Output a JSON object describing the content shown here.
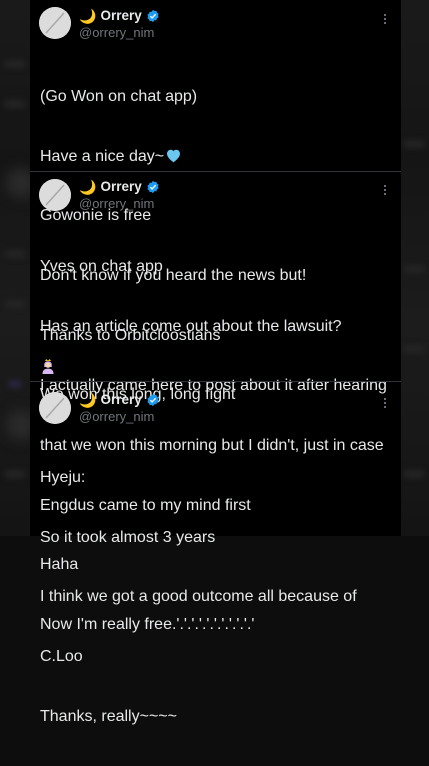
{
  "tweets": [
    {
      "author": {
        "moon": "🌙",
        "display_name": "Orrery",
        "handle": "@orrery_nim",
        "verified": true
      },
      "lines": [
        "(Go Won on chat app)",
        "Have a nice day~",
        "Gowonie is free",
        "Don't know if you heard the news but!",
        "Thanks to Orbitcloostians",
        "We won this long, long fight"
      ],
      "trailing_emoji": "light-blue-heart-icon"
    },
    {
      "author": {
        "moon": "🌙",
        "display_name": "Orrery",
        "handle": "@orrery_nim",
        "verified": true
      },
      "lines": [
        "Yves on chat app",
        "Has an article come out about the lawsuit?",
        "I actually came here to post about it after hearing",
        "that we won this morning but I didn't, just in case",
        "Engdus came to my mind first",
        "Haha",
        "Now I'm really free.'.'.'.'.'.'.'.'.'.'.'"
      ],
      "trailing_emoji": "crowned-person-icon"
    },
    {
      "author": {
        "moon": "🌙",
        "display_name": "Orrery",
        "handle": "@orrery_nim",
        "verified": true
      },
      "lines": [
        "Hyeju:",
        "So it took almost 3 years",
        "I think we got a good outcome all because of",
        "C.Loo",
        "Thanks, really~~~~"
      ]
    }
  ],
  "colors": {
    "background": "#000000",
    "text": "#e7e9ea",
    "handle": "#71767b",
    "verified": "#1d9bf0",
    "divider": "#2f3336"
  }
}
